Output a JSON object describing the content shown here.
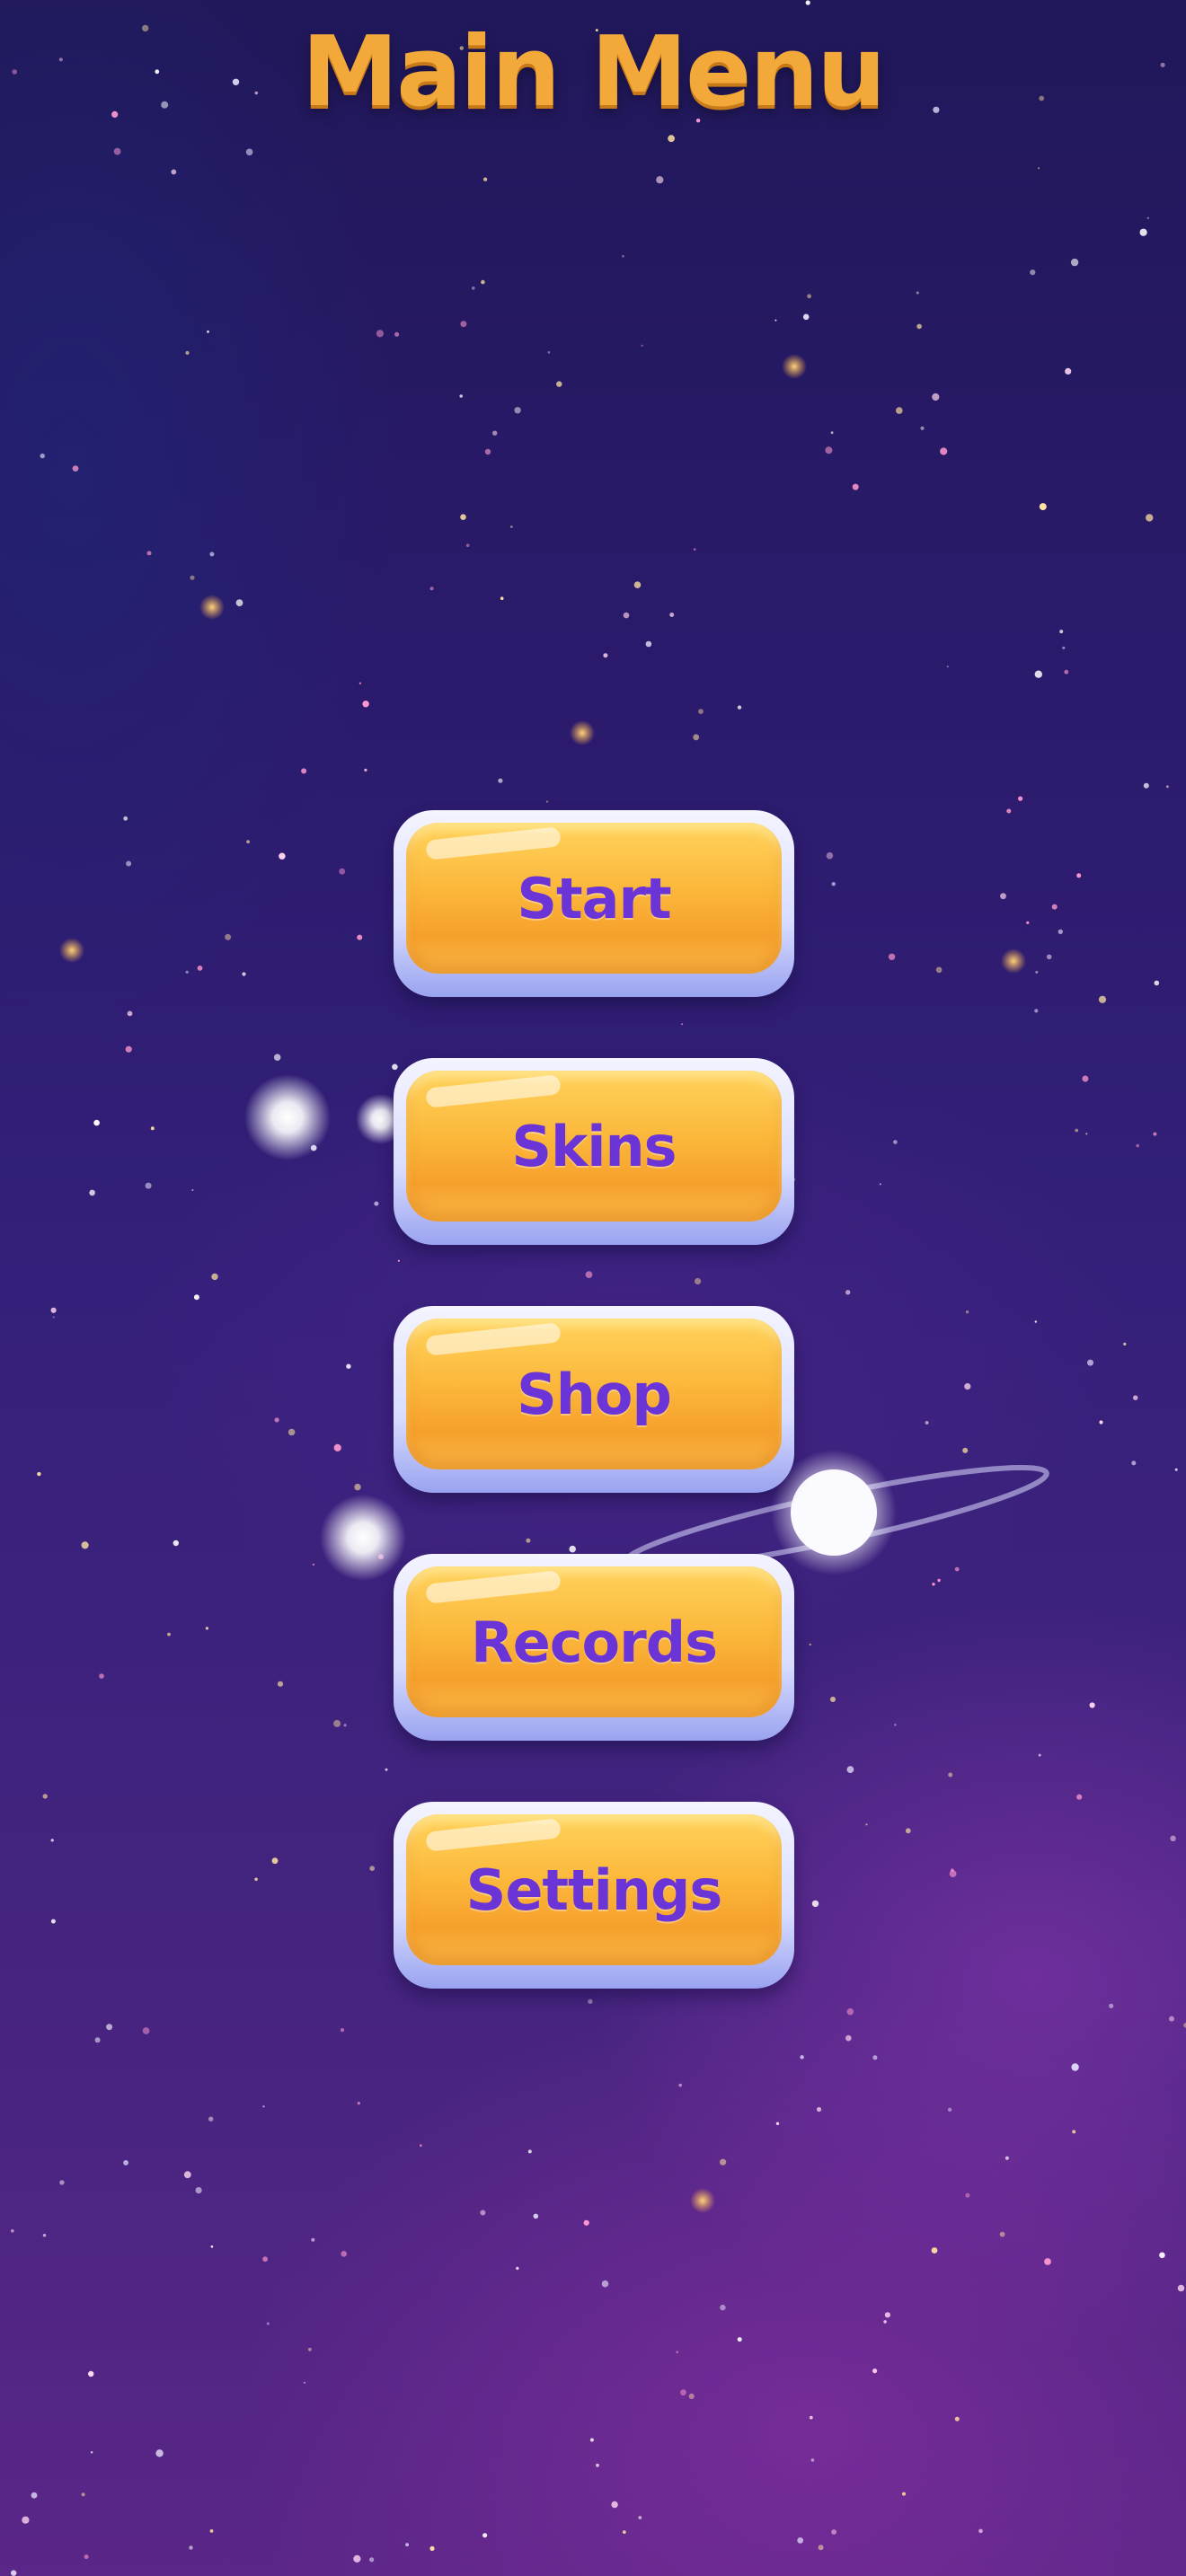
{
  "screen": {
    "title": "Main Menu"
  },
  "menu": {
    "buttons": [
      {
        "label": "Start"
      },
      {
        "label": "Skins"
      },
      {
        "label": "Shop"
      },
      {
        "label": "Records"
      },
      {
        "label": "Settings"
      }
    ]
  },
  "colors": {
    "title": "#f3a93a",
    "button_face": "#fbb73a",
    "button_border": "#d8dcff",
    "button_text": "#6a34d6",
    "background_top": "#20185a",
    "background_bottom": "#5a2687"
  },
  "icons": {
    "background": "starfield-background",
    "planet": "ringed-planet-icon"
  }
}
